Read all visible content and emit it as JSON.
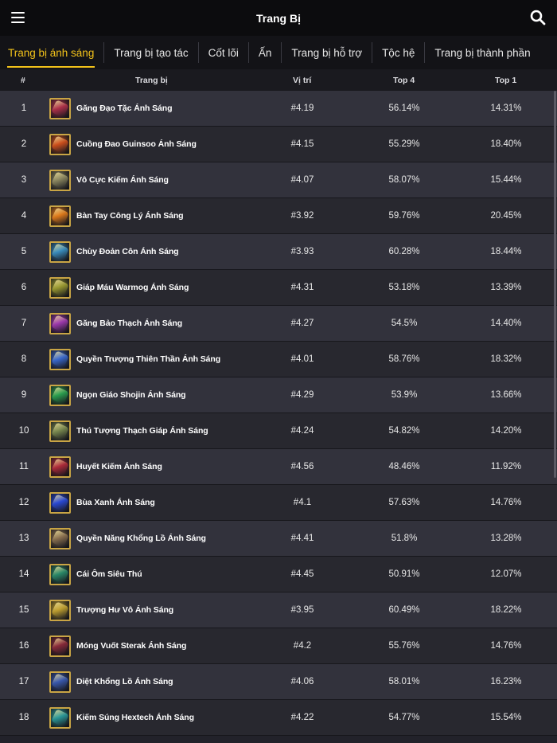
{
  "header": {
    "title": "Trang Bị",
    "menu_icon": "hamburger-menu-icon",
    "search_icon": "search-icon"
  },
  "tabs": [
    {
      "label": "Trang bị ánh sáng",
      "active": true
    },
    {
      "label": "Trang bị tạo tác",
      "active": false
    },
    {
      "label": "Cốt lõi",
      "active": false
    },
    {
      "label": "Ấn",
      "active": false
    },
    {
      "label": "Trang bị hỗ trợ",
      "active": false
    },
    {
      "label": "Tộc hệ",
      "active": false
    },
    {
      "label": "Trang bị thành phần",
      "active": false
    }
  ],
  "columns": {
    "rank": "#",
    "item": "Trang bị",
    "position": "Vị trí",
    "top4": "Top 4",
    "top1": "Top 1"
  },
  "colors": {
    "accent": "#f2c21a",
    "icon_border": "#c9a545"
  },
  "items": [
    {
      "rank": "1",
      "name": "Găng Đạo Tặc Ánh Sáng",
      "position": "#4.19",
      "top4": "56.14%",
      "top1": "14.31%",
      "icon": "thiefs-gloves-radiant-icon",
      "icon_color": "#b0304a"
    },
    {
      "rank": "2",
      "name": "Cuồng Đao Guinsoo Ánh Sáng",
      "position": "#4.15",
      "top4": "55.29%",
      "top1": "18.40%",
      "icon": "guinsoos-rageblade-radiant-icon",
      "icon_color": "#d0501c"
    },
    {
      "rank": "3",
      "name": "Vô Cực Kiếm Ánh Sáng",
      "position": "#4.07",
      "top4": "58.07%",
      "top1": "15.44%",
      "icon": "infinity-edge-radiant-icon",
      "icon_color": "#8a8660"
    },
    {
      "rank": "4",
      "name": "Bàn Tay Công Lý Ánh Sáng",
      "position": "#3.92",
      "top4": "59.76%",
      "top1": "20.45%",
      "icon": "hand-of-justice-radiant-icon",
      "icon_color": "#e07a1a"
    },
    {
      "rank": "5",
      "name": "Chùy Đoản Côn Ánh Sáng",
      "position": "#3.93",
      "top4": "60.28%",
      "top1": "18.44%",
      "icon": "last-whisper-radiant-icon",
      "icon_color": "#3a8fc0"
    },
    {
      "rank": "6",
      "name": "Giáp Máu Warmog Ánh Sáng",
      "position": "#4.31",
      "top4": "53.18%",
      "top1": "13.39%",
      "icon": "warmogs-armor-radiant-icon",
      "icon_color": "#9a9a30"
    },
    {
      "rank": "7",
      "name": "Găng Bảo Thạch Ánh Sáng",
      "position": "#4.27",
      "top4": "54.5%",
      "top1": "14.40%",
      "icon": "jeweled-gauntlet-radiant-icon",
      "icon_color": "#a03ab0"
    },
    {
      "rank": "8",
      "name": "Quyền Trượng Thiên Thần Ánh Sáng",
      "position": "#4.01",
      "top4": "58.76%",
      "top1": "18.32%",
      "icon": "archangels-staff-radiant-icon",
      "icon_color": "#3a6ad0"
    },
    {
      "rank": "9",
      "name": "Ngọn Giáo Shojin Ánh Sáng",
      "position": "#4.29",
      "top4": "53.9%",
      "top1": "13.66%",
      "icon": "spear-of-shojin-radiant-icon",
      "icon_color": "#2aa050"
    },
    {
      "rank": "10",
      "name": "Thú Tượng Thạch Giáp Ánh Sáng",
      "position": "#4.24",
      "top4": "54.82%",
      "top1": "14.20%",
      "icon": "gargoyle-stoneplate-radiant-icon",
      "icon_color": "#7a8a50"
    },
    {
      "rank": "11",
      "name": "Huyết Kiếm Ánh Sáng",
      "position": "#4.56",
      "top4": "48.46%",
      "top1": "11.92%",
      "icon": "bloodthirster-radiant-icon",
      "icon_color": "#b02a3a"
    },
    {
      "rank": "12",
      "name": "Bùa Xanh Ánh Sáng",
      "position": "#4.1",
      "top4": "57.63%",
      "top1": "14.76%",
      "icon": "blue-buff-radiant-icon",
      "icon_color": "#2a4ad8"
    },
    {
      "rank": "13",
      "name": "Quyền Năng Khổng Lồ Ánh Sáng",
      "position": "#4.41",
      "top4": "51.8%",
      "top1": "13.28%",
      "icon": "titans-resolve-radiant-icon",
      "icon_color": "#8a7050"
    },
    {
      "rank": "14",
      "name": "Cái Ôm Siêu Thú",
      "position": "#4.45",
      "top4": "50.91%",
      "top1": "12.07%",
      "icon": "snipers-focus-icon",
      "icon_color": "#2a8a6a"
    },
    {
      "rank": "15",
      "name": "Trượng Hư Vô Ánh Sáng",
      "position": "#3.95",
      "top4": "60.49%",
      "top1": "18.22%",
      "icon": "void-staff-radiant-icon",
      "icon_color": "#c0a030"
    },
    {
      "rank": "16",
      "name": "Móng Vuốt Sterak Ánh Sáng",
      "position": "#4.2",
      "top4": "55.76%",
      "top1": "14.76%",
      "icon": "steraks-gage-radiant-icon",
      "icon_color": "#8a2a3a"
    },
    {
      "rank": "17",
      "name": "Diệt Khổng Lồ Ánh Sáng",
      "position": "#4.06",
      "top4": "58.01%",
      "top1": "16.23%",
      "icon": "giant-slayer-radiant-icon",
      "icon_color": "#3a5ab0"
    },
    {
      "rank": "18",
      "name": "Kiếm Súng Hextech Ánh Sáng",
      "position": "#4.22",
      "top4": "54.77%",
      "top1": "15.54%",
      "icon": "hextech-gunblade-radiant-icon",
      "icon_color": "#2a9a9a"
    }
  ]
}
